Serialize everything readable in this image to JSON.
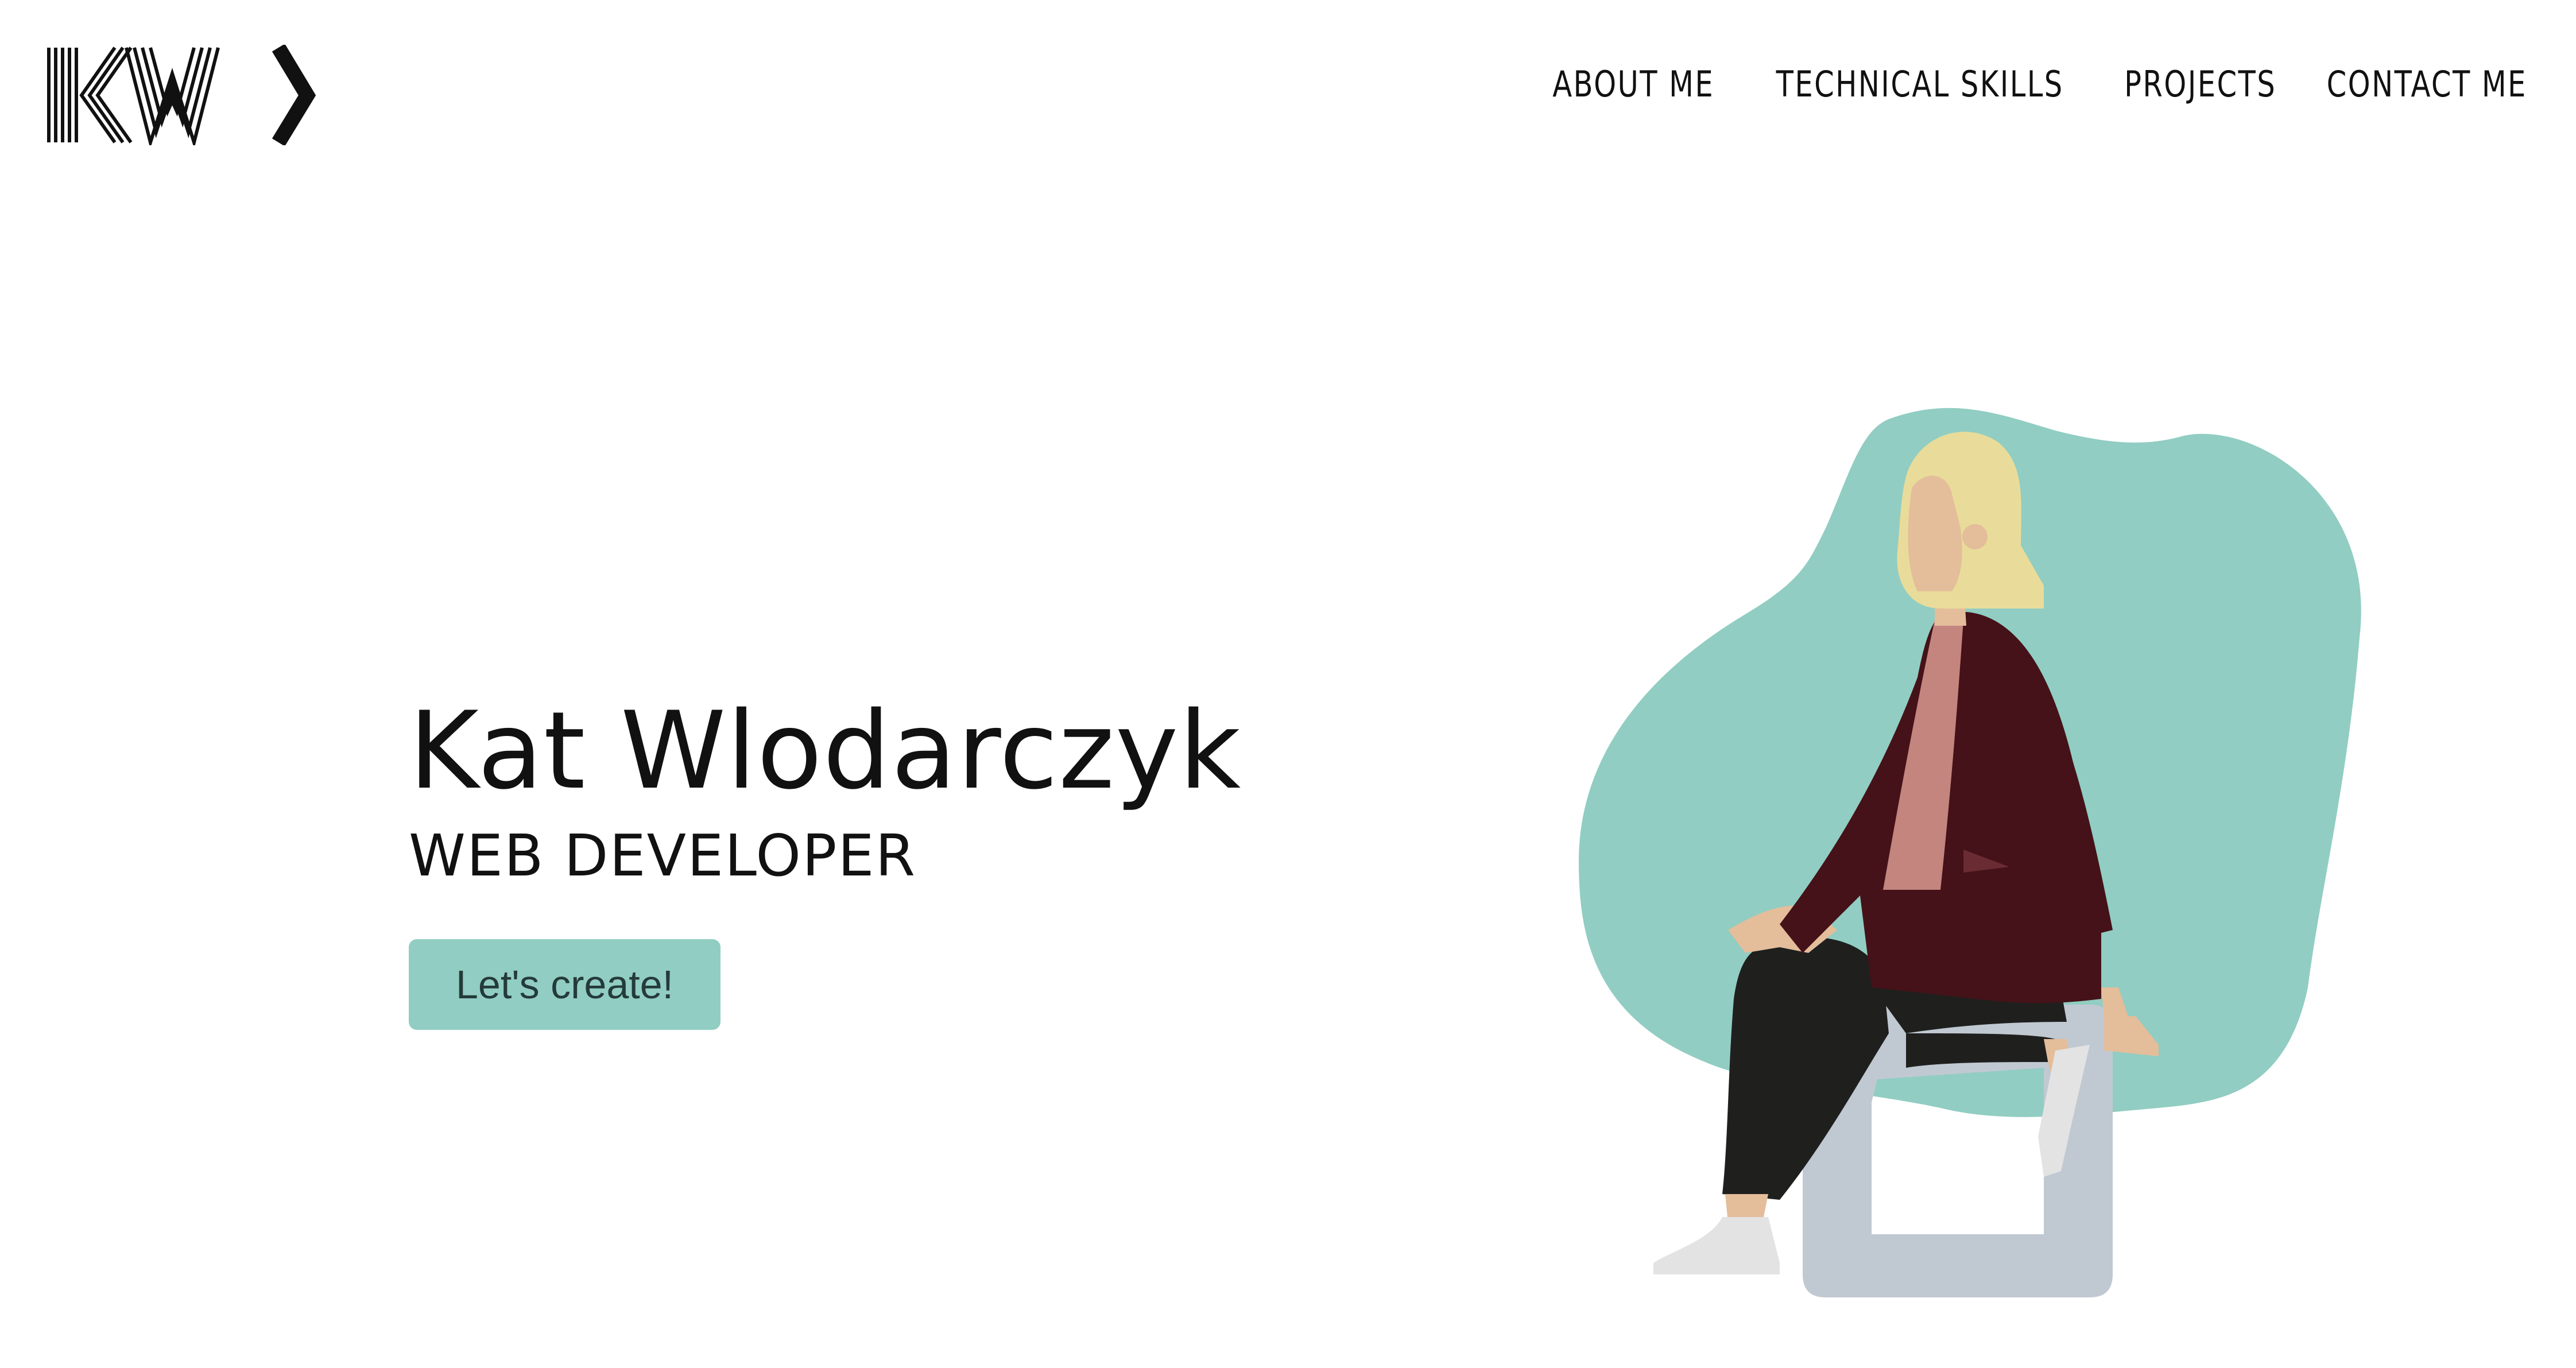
{
  "header": {
    "logo_text": "KW",
    "nav": [
      {
        "label": "ABOUT ME"
      },
      {
        "label": "TECHNICAL SKILLS"
      },
      {
        "label": "PROJECTS"
      },
      {
        "label": "CONTACT ME"
      }
    ]
  },
  "hero": {
    "name": "Kat Wlodarczyk",
    "role": "WEB DEVELOPER",
    "cta_label": "Let's create!"
  },
  "colors": {
    "accent": "#91cdc2",
    "text": "#111111",
    "jacket": "#441218",
    "hair": "#e9dc9a",
    "skin": "#e4bd9a",
    "shirt": "#c4857f",
    "pants": "#1f201e",
    "stool": "#c0c9d2",
    "shoe": "#e3e3e3"
  },
  "icons": {
    "logo": "kw-monogram-logo",
    "illustration": "woman-sitting-on-stool-illustration"
  }
}
